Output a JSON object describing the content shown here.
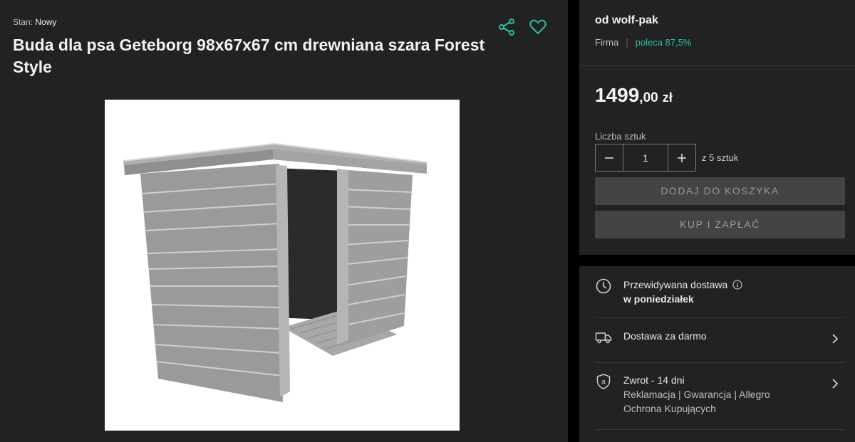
{
  "product": {
    "condition_label": "Stan:",
    "condition_value": "Nowy",
    "title": "Buda dla psa Geteborg 98x67x67 cm drewniana szara Forest Style"
  },
  "icons": {
    "share": "share-icon",
    "favorite": "heart-icon",
    "clock": "clock-icon",
    "truck": "truck-icon",
    "shield": "shield-icon",
    "info": "info-icon",
    "chevron": "chevron-right-icon"
  },
  "seller": {
    "name": "od wolf-pak",
    "type": "Firma",
    "separator": "|",
    "recommend": "poleca 87,5%"
  },
  "price": {
    "integer": "1499",
    "decimal": ",00",
    "currency": "zł"
  },
  "quantity": {
    "label": "Liczba sztuk",
    "value": "1",
    "available": "z 5 sztuk"
  },
  "buttons": {
    "add_to_cart": "DODAJ DO KOSZYKA",
    "buy_now": "KUP I ZAPŁAĆ"
  },
  "delivery": {
    "label": "Przewidywana dostawa",
    "date": "w poniedziałek",
    "free": "Dostawa za darmo",
    "return_title": "Zwrot - 14 dni",
    "return_details": "Reklamacja | Gwarancja | Allegro",
    "return_details2": "Ochrona Kupujących"
  },
  "colors": {
    "panel": "#222222",
    "accent": "#2fbfa5",
    "button": "#444444",
    "background": "#000000"
  }
}
